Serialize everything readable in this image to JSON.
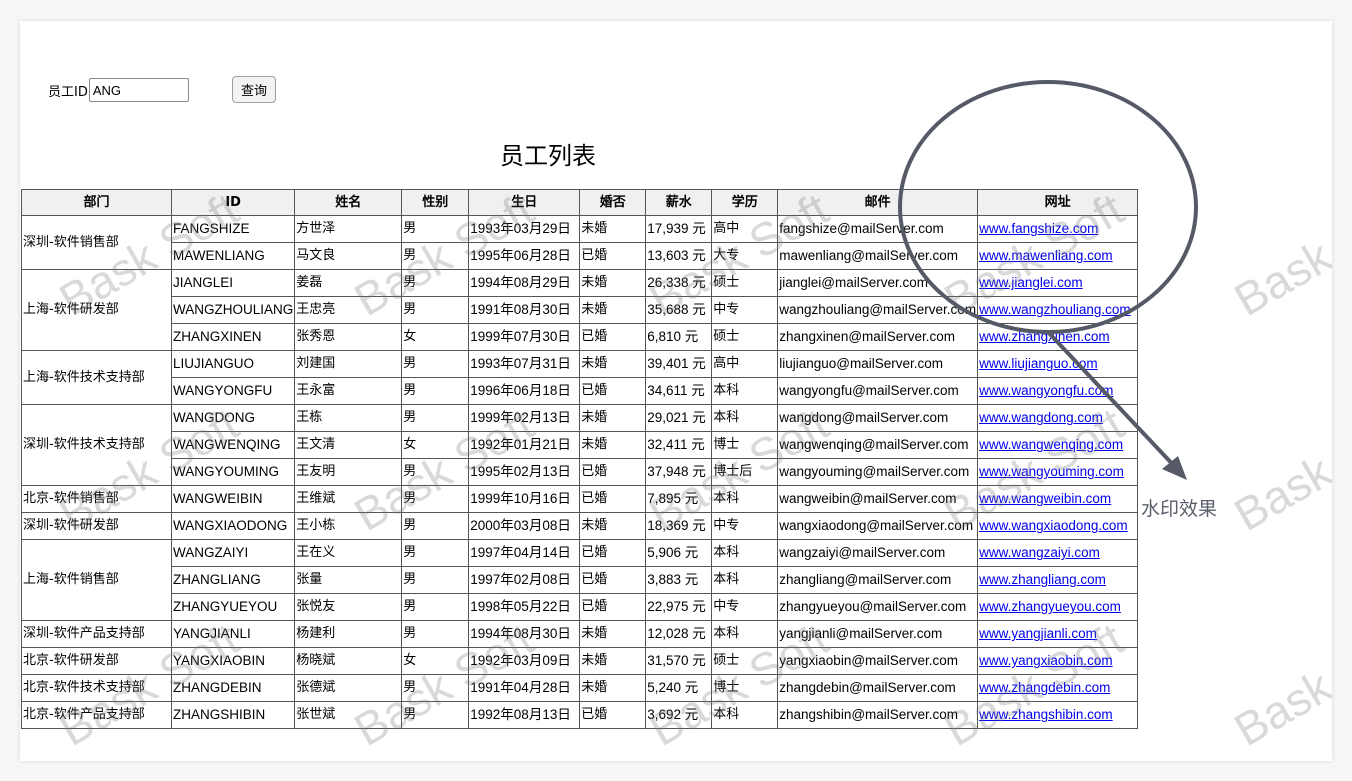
{
  "search": {
    "label": "员工ID",
    "value": "ANG",
    "button_label": "查询"
  },
  "page_title": "员工列表",
  "table": {
    "headers": [
      "部门",
      "ID",
      "姓名",
      "性别",
      "生日",
      "婚否",
      "薪水",
      "学历",
      "邮件",
      "网址"
    ],
    "groups": [
      {
        "dept": "深圳-软件销售部",
        "rows": [
          [
            "FANGSHIZE",
            "方世泽",
            "男",
            "1993年03月29日",
            "未婚",
            "17,939 元",
            "高中",
            "fangshize@mailServer.com",
            "www.fangshize.com"
          ],
          [
            "MAWENLIANG",
            "马文良",
            "男",
            "1995年06月28日",
            "已婚",
            "13,603 元",
            "大专",
            "mawenliang@mailServer.com",
            "www.mawenliang.com"
          ]
        ]
      },
      {
        "dept": "上海-软件研发部",
        "rows": [
          [
            "JIANGLEI",
            "姜磊",
            "男",
            "1994年08月29日",
            "未婚",
            "26,338 元",
            "硕士",
            "jianglei@mailServer.com",
            "www.jianglei.com"
          ],
          [
            "WANGZHOULIANG",
            "王忠亮",
            "男",
            "1991年08月30日",
            "未婚",
            "35,688 元",
            "中专",
            "wangzhouliang@mailServer.com",
            "www.wangzhouliang.com"
          ],
          [
            "ZHANGXINEN",
            "张秀恩",
            "女",
            "1999年07月30日",
            "已婚",
            "6,810 元",
            "硕士",
            "zhangxinen@mailServer.com",
            "www.zhangxinen.com"
          ]
        ]
      },
      {
        "dept": "上海-软件技术支持部",
        "rows": [
          [
            "LIUJIANGUO",
            "刘建国",
            "男",
            "1993年07月31日",
            "未婚",
            "39,401 元",
            "高中",
            "liujianguo@mailServer.com",
            "www.liujianguo.com"
          ],
          [
            "WANGYONGFU",
            "王永富",
            "男",
            "1996年06月18日",
            "已婚",
            "34,611 元",
            "本科",
            "wangyongfu@mailServer.com",
            "www.wangyongfu.com"
          ]
        ]
      },
      {
        "dept": "深圳-软件技术支持部",
        "rows": [
          [
            "WANGDONG",
            "王栋",
            "男",
            "1999年02月13日",
            "未婚",
            "29,021 元",
            "本科",
            "wangdong@mailServer.com",
            "www.wangdong.com"
          ],
          [
            "WANGWENQING",
            "王文清",
            "女",
            "1992年01月21日",
            "未婚",
            "32,411 元",
            "博士",
            "wangwenqing@mailServer.com",
            "www.wangwenqing.com"
          ],
          [
            "WANGYOUMING",
            "王友明",
            "男",
            "1995年02月13日",
            "已婚",
            "37,948 元",
            "博士后",
            "wangyouming@mailServer.com",
            "www.wangyouming.com"
          ]
        ]
      },
      {
        "dept": "北京-软件销售部",
        "rows": [
          [
            "WANGWEIBIN",
            "王维斌",
            "男",
            "1999年10月16日",
            "已婚",
            "7,895 元",
            "本科",
            "wangweibin@mailServer.com",
            "www.wangweibin.com"
          ]
        ]
      },
      {
        "dept": "深圳-软件研发部",
        "rows": [
          [
            "WANGXIAODONG",
            "王小栋",
            "男",
            "2000年03月08日",
            "未婚",
            "18,369 元",
            "中专",
            "wangxiaodong@mailServer.com",
            "www.wangxiaodong.com"
          ]
        ]
      },
      {
        "dept": "上海-软件销售部",
        "rows": [
          [
            "WANGZAIYI",
            "王在义",
            "男",
            "1997年04月14日",
            "已婚",
            "5,906 元",
            "本科",
            "wangzaiyi@mailServer.com",
            "www.wangzaiyi.com"
          ],
          [
            "ZHANGLIANG",
            "张量",
            "男",
            "1997年02月08日",
            "已婚",
            "3,883 元",
            "本科",
            "zhangliang@mailServer.com",
            "www.zhangliang.com"
          ],
          [
            "ZHANGYUEYOU",
            "张悦友",
            "男",
            "1998年05月22日",
            "已婚",
            "22,975 元",
            "中专",
            "zhangyueyou@mailServer.com",
            "www.zhangyueyou.com"
          ]
        ]
      },
      {
        "dept": "深圳-软件产品支持部",
        "rows": [
          [
            "YANGJIANLI",
            "杨建利",
            "男",
            "1994年08月30日",
            "未婚",
            "12,028 元",
            "本科",
            "yangjianli@mailServer.com",
            "www.yangjianli.com"
          ]
        ]
      },
      {
        "dept": "北京-软件研发部",
        "rows": [
          [
            "YANGXIAOBIN",
            "杨晓斌",
            "女",
            "1992年03月09日",
            "未婚",
            "31,570 元",
            "硕士",
            "yangxiaobin@mailServer.com",
            "www.yangxiaobin.com"
          ]
        ]
      },
      {
        "dept": "北京-软件技术支持部",
        "rows": [
          [
            "ZHANGDEBIN",
            "张德斌",
            "男",
            "1991年04月28日",
            "未婚",
            "5,240 元",
            "博士",
            "zhangdebin@mailServer.com",
            "www.zhangdebin.com"
          ]
        ]
      },
      {
        "dept": "北京-软件产品支持部",
        "rows": [
          [
            "ZHANGSHIBIN",
            "张世斌",
            "男",
            "1992年08月13日",
            "已婚",
            "3,692 元",
            "本科",
            "zhangshibin@mailServer.com",
            "www.zhangshibin.com"
          ]
        ]
      }
    ]
  },
  "watermark": {
    "text": "Bask Soft"
  },
  "annotation": {
    "label": "水印效果",
    "color": "#555a66"
  }
}
